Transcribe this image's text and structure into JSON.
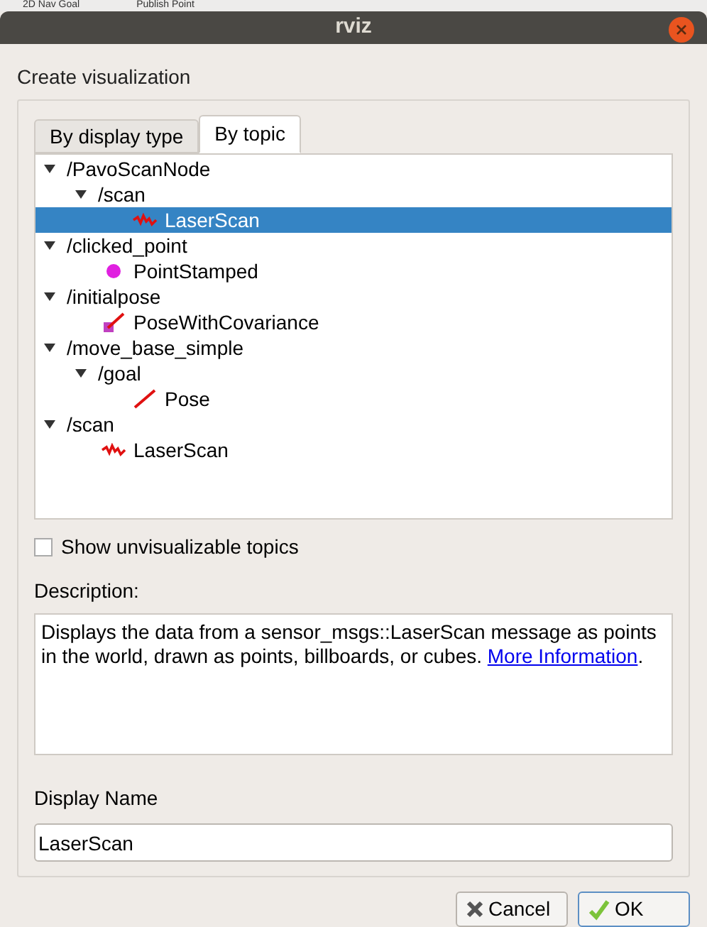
{
  "background_toolbar": [
    "2D Nav Goal",
    "Publish Point"
  ],
  "window": {
    "title": "rviz"
  },
  "heading": "Create visualization",
  "tabs": [
    {
      "label": "By display type",
      "selected": false
    },
    {
      "label": "By topic",
      "selected": true
    }
  ],
  "tree": [
    {
      "label": "/PavoScanNode",
      "expanded": true,
      "selected": false,
      "children": [
        {
          "label": "/scan",
          "expanded": true,
          "selected": false,
          "children": [
            {
              "label": "LaserScan",
              "kind": "laser",
              "selected": true
            }
          ]
        }
      ]
    },
    {
      "label": "/clicked_point",
      "expanded": true,
      "selected": false,
      "children": [
        {
          "label": "PointStamped",
          "kind": "point",
          "selected": false
        }
      ]
    },
    {
      "label": "/initialpose",
      "expanded": true,
      "selected": false,
      "children": [
        {
          "label": "PoseWithCovariance",
          "kind": "pose_cov",
          "selected": false
        }
      ]
    },
    {
      "label": "/move_base_simple",
      "expanded": true,
      "selected": false,
      "children": [
        {
          "label": "/goal",
          "expanded": true,
          "selected": false,
          "children": [
            {
              "label": "Pose",
              "kind": "pose",
              "selected": false
            }
          ]
        }
      ]
    },
    {
      "label": "/scan",
      "expanded": true,
      "selected": false,
      "children": [
        {
          "label": "LaserScan",
          "kind": "laser",
          "selected": false
        }
      ]
    }
  ],
  "show_unvisualizable": {
    "label": "Show unvisualizable topics",
    "checked": false
  },
  "description": {
    "label": "Description:",
    "text": "Displays the data from a sensor_msgs::LaserScan message as points in the world, drawn as points, billboards, or cubes. ",
    "link": "More Information",
    "after": "."
  },
  "display_name": {
    "label": "Display Name",
    "value": "LaserScan"
  },
  "buttons": [
    {
      "label": "Cancel",
      "kind": "cancel"
    },
    {
      "label": "OK",
      "kind": "ok"
    }
  ]
}
